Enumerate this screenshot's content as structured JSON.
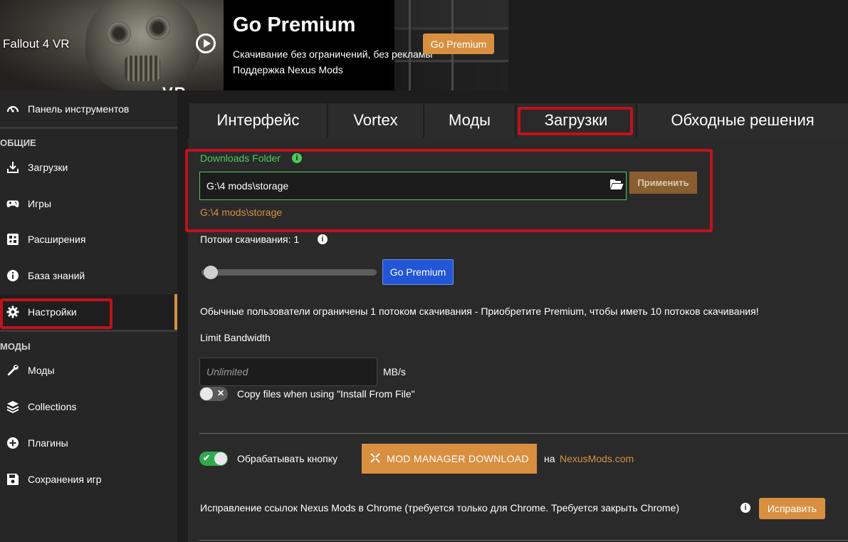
{
  "header": {
    "game_title": "Fallout 4 VR",
    "banner_overlay_text": "VR",
    "premium_title": "Go Premium",
    "premium_line1": "Скачивание без ограничений, без рекламы",
    "premium_line2": "Поддержка Nexus Mods",
    "premium_button": "Go Premium"
  },
  "sidebar": {
    "dashboard": "Панель инструментов",
    "section_general": "ОБЩИЕ",
    "items_general": [
      "Загрузки",
      "Игры",
      "Расширения",
      "База знаний",
      "Настройки"
    ],
    "section_mods": "МОДЫ",
    "items_mods": [
      "Моды",
      "Collections",
      "Плагины",
      "Сохранения игр"
    ],
    "active": "Настройки"
  },
  "tabs": [
    "Интерфейс",
    "Vortex",
    "Моды",
    "Загрузки",
    "Обходные решения"
  ],
  "active_tab": "Загрузки",
  "downloads": {
    "folder_label": "Downloads Folder",
    "folder_value": "G:\\4 mods\\storage",
    "apply_button": "Применить",
    "resolved_path": "G:\\4 mods\\storage",
    "threads_label": "Потоки скачивания: 1",
    "threads_value": 1,
    "threads_go_premium": "Go Premium",
    "notice": "Обычные пользователи ограничены 1 потоком скачивания - Приобретите Premium, чтобы иметь 10 потоков скачивания!",
    "bandwidth_label": "Limit Bandwidth",
    "bandwidth_placeholder": "Unlimited",
    "bandwidth_unit": "MB/s",
    "copy_files_label": "Copy files when using \"Install From File\"",
    "copy_files_enabled": false,
    "handle_label": "Обрабатывать кнопку",
    "handle_enabled": true,
    "mod_manager_button": "MOD MANAGER DOWNLOAD",
    "on_label": "на",
    "nexus_link": "NexusMods.com",
    "chrome_fix_label": "Исправление ссылок Nexus Mods в Chrome (требуется только для Chrome. Требуется закрыть Chrome)",
    "fix_button": "Исправить"
  },
  "colors": {
    "accent": "#d98f40",
    "highlight": "#c0121b",
    "green": "#4cc95b",
    "blue": "#2356d6"
  }
}
